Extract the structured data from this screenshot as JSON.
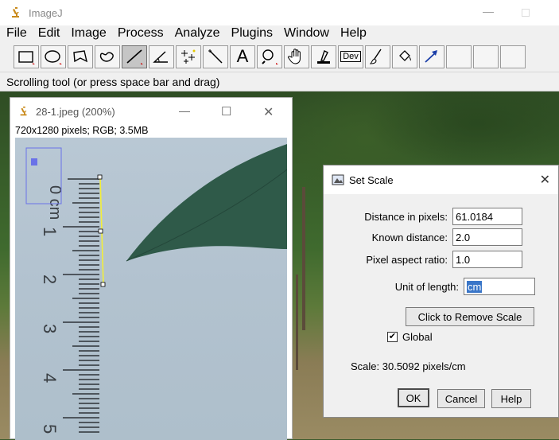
{
  "main_window": {
    "title": "ImageJ",
    "menu": [
      "File",
      "Edit",
      "Image",
      "Process",
      "Analyze",
      "Plugins",
      "Window",
      "Help"
    ],
    "status_text": "Scrolling tool (or press space bar and drag)",
    "tools": [
      {
        "name": "rectangle-tool",
        "icon": "rectangle-icon"
      },
      {
        "name": "oval-tool",
        "icon": "oval-icon"
      },
      {
        "name": "polygon-tool",
        "icon": "polygon-icon"
      },
      {
        "name": "freehand-tool",
        "icon": "freehand-icon"
      },
      {
        "name": "line-tool",
        "icon": "straight-line-icon",
        "active": true
      },
      {
        "name": "angle-tool",
        "icon": "angle-icon"
      },
      {
        "name": "point-tool",
        "icon": "multipoint-icon"
      },
      {
        "name": "wand-tool",
        "icon": "wand-icon"
      },
      {
        "name": "text-tool",
        "icon": "text-icon",
        "label": "A"
      },
      {
        "name": "magnifying-tool",
        "icon": "magnifier-icon"
      },
      {
        "name": "scrolling-tool",
        "icon": "hand-icon"
      },
      {
        "name": "color-picker-tool",
        "icon": "eyedropper-icon"
      },
      {
        "name": "dev-menu-tool",
        "icon": "dev-icon",
        "label": "Dev"
      },
      {
        "name": "brush-tool",
        "icon": "brush-icon"
      },
      {
        "name": "flood-fill-tool",
        "icon": "bucket-icon"
      },
      {
        "name": "arrow-tool",
        "icon": "arrow-icon"
      },
      {
        "name": "empty-slot-1",
        "icon": ""
      },
      {
        "name": "empty-slot-2",
        "icon": ""
      },
      {
        "name": "empty-slot-3",
        "icon": ""
      }
    ]
  },
  "image_window": {
    "title": "28-1.jpeg (200%)",
    "info": "720x1280 pixels; RGB; 3.5MB",
    "ruler_labels": [
      "0 cm",
      "1",
      "2",
      "3",
      "4",
      "5"
    ]
  },
  "set_scale": {
    "title": "Set Scale",
    "distance_label": "Distance in pixels:",
    "distance_value": "61.0184",
    "known_label": "Known distance:",
    "known_value": "2.0",
    "aspect_label": "Pixel aspect ratio:",
    "aspect_value": "1.0",
    "unit_label": "Unit of length:",
    "unit_value": "cm",
    "remove_scale_label": "Click to Remove Scale",
    "global_label": "Global",
    "global_checked": true,
    "scale_text": "Scale: 30.5092 pixels/cm",
    "ok_label": "OK",
    "cancel_label": "Cancel",
    "help_label": "Help"
  },
  "colors": {
    "selection_line": "#f2ee3a",
    "leaf": "#2f5a49",
    "unit_highlight": "#3a76c8"
  }
}
